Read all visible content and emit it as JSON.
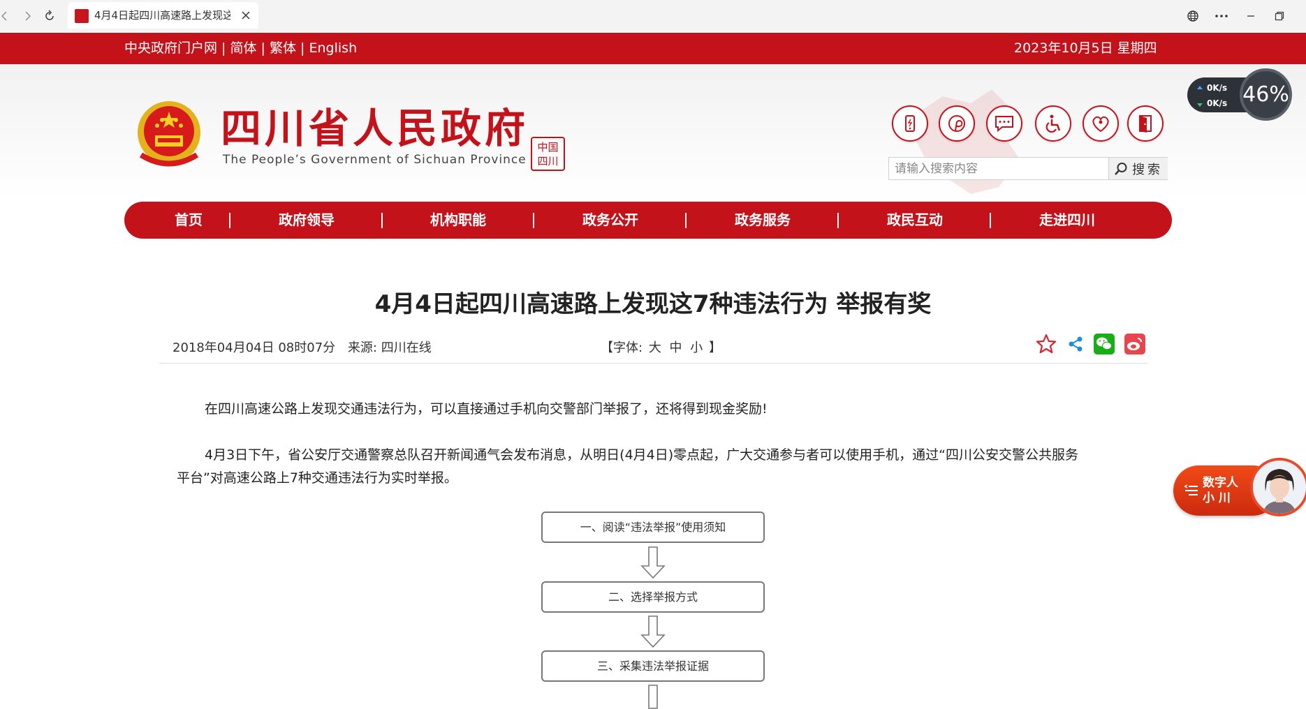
{
  "browser": {
    "tab_title": "4月4日起四川高速路上发现这",
    "favicon_text": "四川"
  },
  "topbar": {
    "links": [
      "中央政府门户网",
      "简体",
      "繁体",
      "English"
    ],
    "separator": " | ",
    "date": "2023年10月5日 星期四"
  },
  "header": {
    "title_cn": "四川省人民政府",
    "title_en": "The People’s Government of Sichuan Province",
    "seal_text": "中国四川",
    "icons": [
      "mobile-icon",
      "pinterest-icon",
      "message-icon",
      "accessibility-icon",
      "elderly-care-icon",
      "exit-door-icon"
    ],
    "search_placeholder": "请输入搜索内容",
    "search_button": "搜索"
  },
  "nav": {
    "items": [
      "首页",
      "政府领导",
      "机构职能",
      "政务公开",
      "政务服务",
      "政民互动",
      "走进四川"
    ]
  },
  "speed_widget": {
    "up": "0K/s",
    "down": "0K/s",
    "percent": "46%"
  },
  "article": {
    "title": "4月4日起四川高速路上发现这7种违法行为 举报有奖",
    "date": "2018年04月04日 08时07分",
    "source_label": "来源:",
    "source": "四川在线",
    "font_label_open": "【字体:",
    "font_sizes": [
      "大",
      "中",
      "小"
    ],
    "font_label_close": "】",
    "share_icons": [
      "favorite-star-icon",
      "share-icon",
      "wechat-icon",
      "weibo-icon"
    ],
    "paragraph1": "在四川高速公路上发现交通违法行为，可以直接通过手机向交警部门举报了，还将得到现金奖励!",
    "paragraph2_line1": "4月3日下午，省公安厅交通警察总队召开新闻通气会发布消息，从明日(4月4日)零点起，广大交通参与者可以使用手机，通过“四川公安交警公共服务",
    "paragraph2_line2": "平台”对高速公路上7种交通违法行为实时举报。",
    "flow_steps": [
      "一、阅读“违法举报”使用须知",
      "二、选择举报方式",
      "三、采集违法举报证据"
    ]
  },
  "digital_human": {
    "line1": "数字人",
    "line2": "小 川"
  },
  "colors": {
    "brand_red": "#c4121b",
    "widget_orange": "#e8461a"
  }
}
